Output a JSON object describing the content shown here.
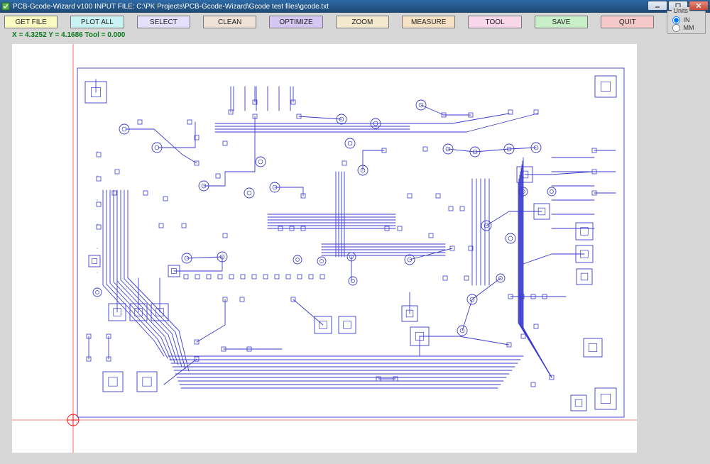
{
  "titlebar": {
    "text": "PCB-Gcode-Wizard v100  INPUT FILE:  C:\\PK Projects\\PCB-Gcode-Wizard\\Gcode test files\\gcode.txt"
  },
  "toolbar": {
    "get_file": "GET FILE",
    "plot_all": "PLOT ALL",
    "select": "SELECT",
    "clean": "CLEAN",
    "optimize": "OPTIMIZE",
    "zoom": "ZOOM",
    "measure": "MEASURE",
    "tool": "TOOL",
    "save": "SAVE",
    "quit": "QUIT"
  },
  "units": {
    "legend": "Units",
    "in_label": "IN",
    "mm_label": "MM",
    "selected": "IN"
  },
  "status": {
    "text": "X = 4.3252    Y = 4.1686    Tool = 0.000"
  },
  "plot": {
    "trace_color": "#3a3acc",
    "axis_color": "#ff0000"
  }
}
